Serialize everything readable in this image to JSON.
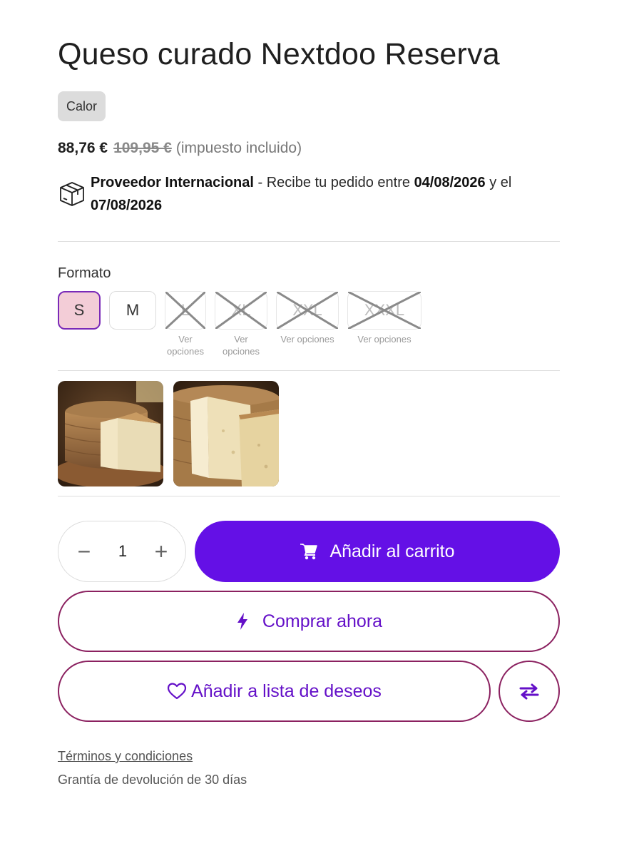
{
  "product": {
    "title": "Queso curado Nextdoo Reserva",
    "tag": "Calor",
    "price": "88,76 €",
    "old_price": "109,95 €",
    "tax_note": "(impuesto incluido)"
  },
  "shipping": {
    "provider": "Proveedor Internacional",
    "text_before": " - Recibe tu pedido entre ",
    "date_from": "04/08/2026",
    "text_between": " y el ",
    "date_to": "07/08/2026"
  },
  "format": {
    "label": "Formato",
    "options": [
      {
        "label": "S",
        "state": "selected",
        "note": ""
      },
      {
        "label": "M",
        "state": "available",
        "note": ""
      },
      {
        "label": "L",
        "state": "unavailable",
        "note": "Ver opciones"
      },
      {
        "label": "XL",
        "state": "unavailable",
        "note": "Ver opciones"
      },
      {
        "label": "XXL",
        "state": "unavailable",
        "note": "Ver opciones"
      },
      {
        "label": "XXXL",
        "state": "unavailable",
        "note": "Ver opciones"
      }
    ]
  },
  "gallery": [
    {
      "icon": "cheese-wheel-photo"
    },
    {
      "icon": "cheese-wedge-photo"
    }
  ],
  "quantity": {
    "value": "1",
    "minus": "−",
    "plus": "+"
  },
  "actions": {
    "add_to_cart": "Añadir al carrito",
    "buy_now": "Comprar ahora",
    "wishlist": "Añadir a lista de deseos"
  },
  "footer": {
    "terms": "Términos y condiciones",
    "warranty": "Grantía de devolución de 30 días"
  },
  "colors": {
    "accent": "#6410e6",
    "outline": "#8b2160",
    "selected_bg": "#f3cdd7"
  }
}
